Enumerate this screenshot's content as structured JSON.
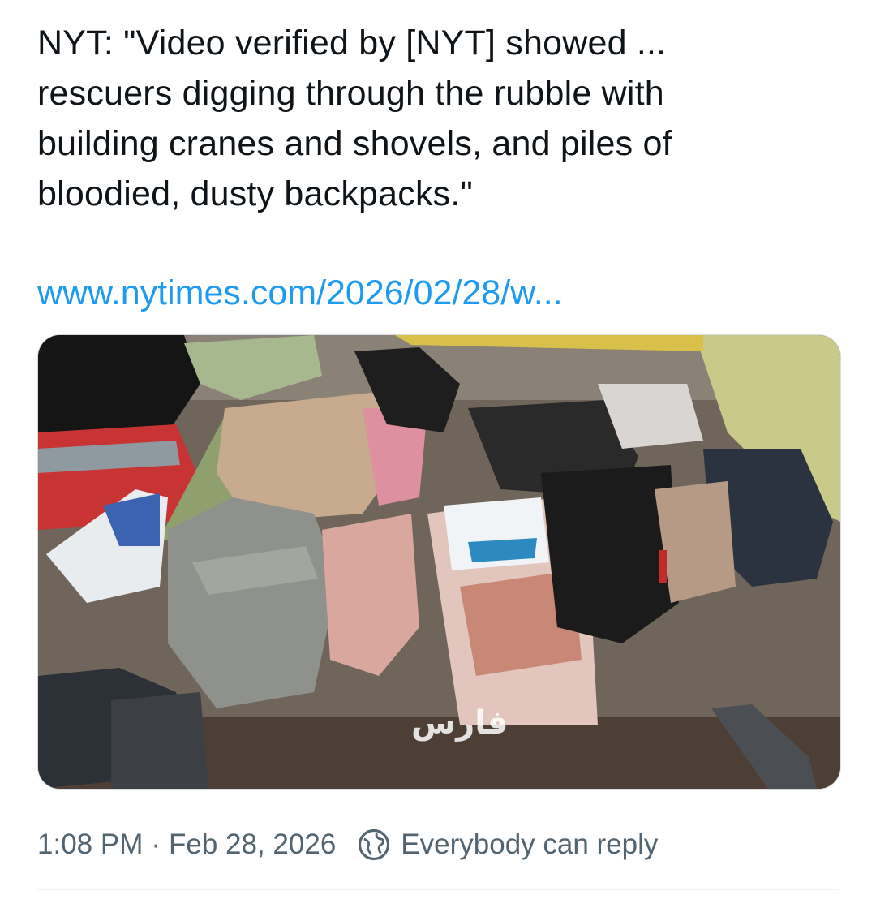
{
  "post": {
    "text": "NYT: \"Video verified by [NYT] showed ...\nrescuers digging through the rubble with\nbuilding cranes and shovels, and piles of\nbloodied, dusty backpacks.\"",
    "link": "www.nytimes.com/2026/02/28/w...",
    "media": {
      "watermark": "فارس"
    },
    "time": "1:08 PM",
    "separator": "·",
    "date": "Feb 28, 2026",
    "reply_setting": "Everybody can reply"
  },
  "colors": {
    "text": "#0f1419",
    "link": "#1d9bf0",
    "meta": "#536471"
  },
  "icons": {
    "reply_setting_icon": "globe-icon"
  }
}
